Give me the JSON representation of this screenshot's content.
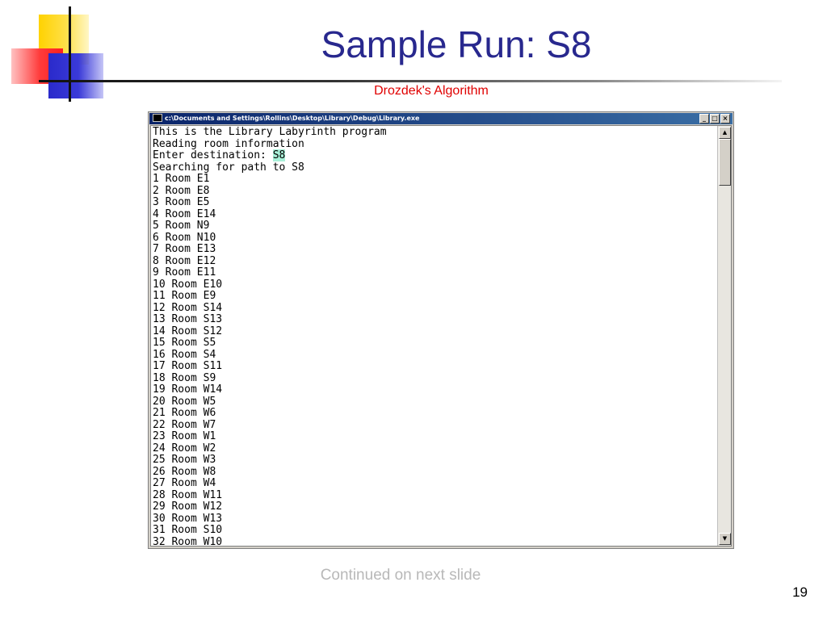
{
  "slide": {
    "title": "Sample Run: S8",
    "subtitle": "Drozdek's Algorithm",
    "footer_note": "Continued on next slide",
    "page_number": "19"
  },
  "console": {
    "window_title": "c:\\Documents and Settings\\Rollins\\Desktop\\Library\\Debug\\Library.exe",
    "window_buttons": {
      "minimize": "_",
      "maximize": "□",
      "close": "×"
    },
    "lines": [
      "This is the Library Labyrinth program",
      "Reading room information",
      "Searching for path to S8",
      "1 Room E1",
      "2 Room E8",
      "3 Room E5",
      "4 Room E14",
      "5 Room N9",
      "6 Room N10",
      "7 Room E13",
      "8 Room E12",
      "9 Room E11",
      "10 Room E10",
      "11 Room E9",
      "12 Room S14",
      "13 Room S13",
      "14 Room S12",
      "15 Room S5",
      "16 Room S4",
      "17 Room S11",
      "18 Room S9",
      "19 Room W14",
      "20 Room W5",
      "21 Room W6",
      "22 Room W7",
      "23 Room W1",
      "24 Room W2",
      "25 Room W3",
      "26 Room W8",
      "27 Room W4",
      "28 Room W11",
      "29 Room W12",
      "30 Room W13",
      "31 Room S10",
      "32 Room W10"
    ],
    "prompt": {
      "label": "Enter destination: ",
      "input": "S8"
    }
  },
  "colors": {
    "title": "#28288e",
    "subtitle": "#e00000",
    "footer": "#b8b8b8",
    "input_highlight": "#a8f0d8"
  }
}
